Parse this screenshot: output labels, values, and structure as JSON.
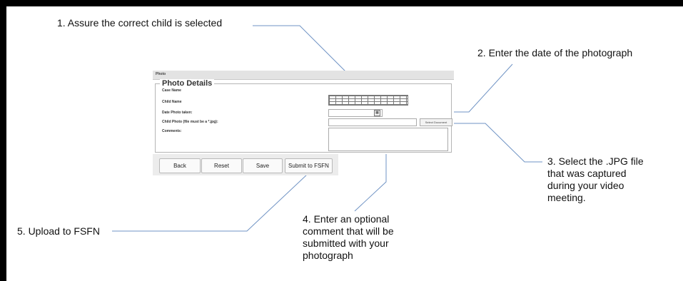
{
  "callouts": {
    "c1": "1. Assure the correct child is selected",
    "c2": "2. Enter the date of the photograph",
    "c3": [
      "3. Select the .JPG file",
      "that was captured",
      "during your video",
      "meeting."
    ],
    "c4": [
      "4. Enter an optional",
      "comment that will be",
      "submitted with your",
      "photograph"
    ],
    "c5": "5. Upload to FSFN"
  },
  "form": {
    "panel_title": "Photo",
    "section_title": "Photo Details",
    "labels": {
      "case_name": "Case Name",
      "child_name": "Child Name",
      "date_taken": "Date Photo taken:",
      "child_photo": "Child Photo (file must be a *.jpg):",
      "comments": "Comments:"
    },
    "select_document_label": "Select Document",
    "calendar_glyph": "▦"
  },
  "buttons": {
    "back": "Back",
    "reset": "Reset",
    "save": "Save",
    "submit": "Submit to FSFN"
  },
  "colors": {
    "leader_line": "#6f93c4",
    "border": "#000000"
  }
}
